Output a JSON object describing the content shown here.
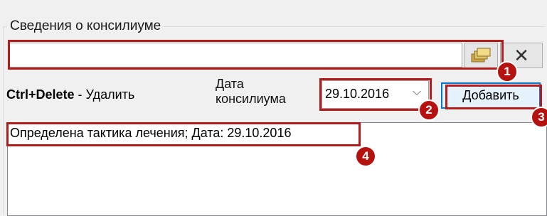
{
  "group": {
    "title": "Сведения о консилиуме"
  },
  "hint": {
    "shortcut": "Ctrl+Delete",
    "separator": " - ",
    "action": "Удалить"
  },
  "date": {
    "label_line1": "Дата",
    "label_line2": "консилиума",
    "value": "29.10.2016",
    "chevron": "⌵"
  },
  "buttons": {
    "add_label": "Добавить",
    "clear_glyph": "✕"
  },
  "list": {
    "items": [
      "Определена тактика лечения; Дата: 29.10.2016"
    ]
  },
  "callouts": [
    "1",
    "2",
    "3",
    "4"
  ],
  "colors": {
    "callout": "#b11d1d",
    "badge": "#b5120f",
    "focus": "#0078d7"
  }
}
